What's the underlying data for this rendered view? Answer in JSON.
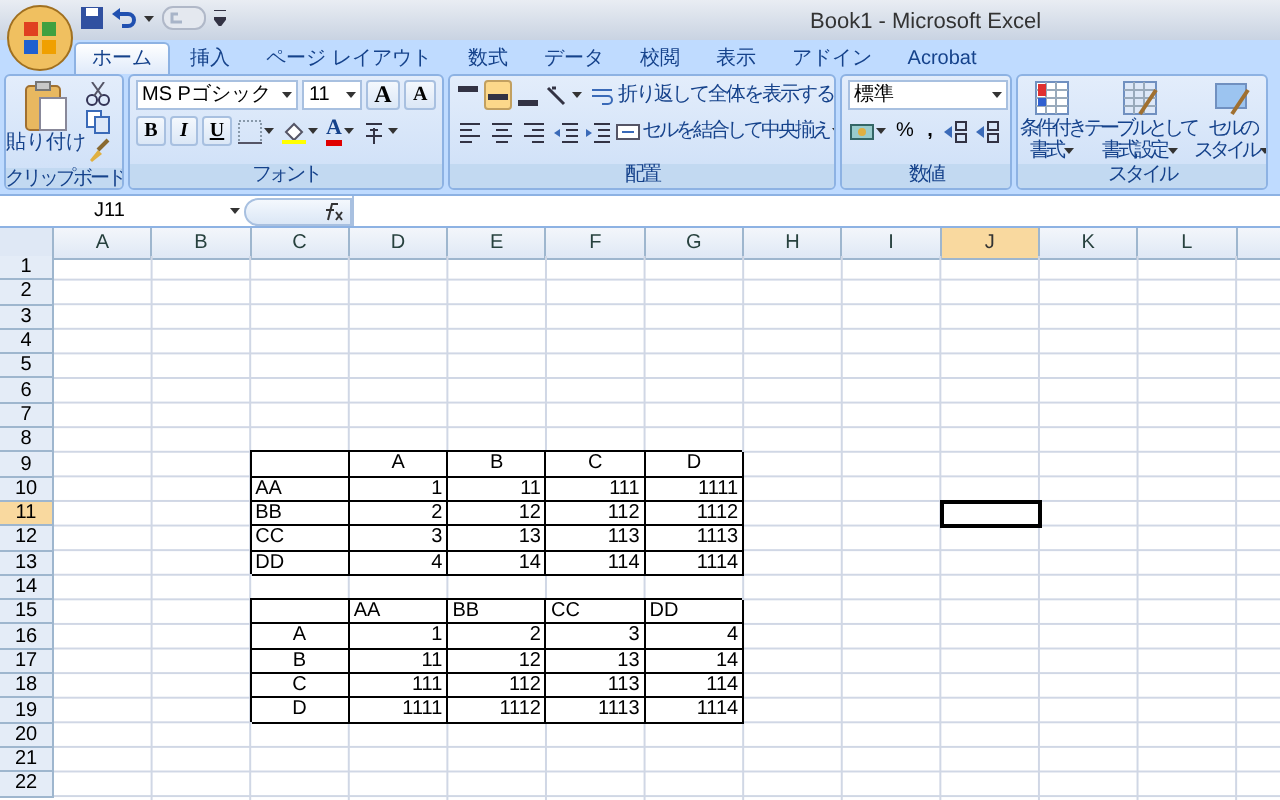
{
  "title_bar": {
    "title": "Book1 - Microsoft Excel"
  },
  "tabs": [
    {
      "label": "ホーム",
      "selected": true
    },
    {
      "label": "挿入",
      "selected": false
    },
    {
      "label": "ページ レイアウト",
      "selected": false
    },
    {
      "label": "数式",
      "selected": false
    },
    {
      "label": "データ",
      "selected": false
    },
    {
      "label": "校閲",
      "selected": false
    },
    {
      "label": "表示",
      "selected": false
    },
    {
      "label": "アドイン",
      "selected": false
    },
    {
      "label": "Acrobat",
      "selected": false
    }
  ],
  "ribbon": {
    "clipboard": {
      "label": "クリップボード",
      "paste": "貼り付け"
    },
    "font": {
      "label": "フォント",
      "font_name": "MS Pゴシック",
      "font_size": "11",
      "grow": "A",
      "shrink": "A",
      "bold": "B",
      "italic": "I",
      "underline": "U",
      "font_color": "A"
    },
    "alignment": {
      "label": "配置",
      "wrap_text": "折り返して全体を表示する",
      "merge_center": "セルを結合して中央揃え",
      "vertical_align": [
        {
          "selected": false
        },
        {
          "selected": true
        },
        {
          "selected": false
        }
      ]
    },
    "number": {
      "label": "数値",
      "format": "標準",
      "percent": "%",
      "comma": ","
    },
    "styles": {
      "label": "スタイル",
      "buttons": [
        {
          "lines": [
            "条件付き",
            "書式"
          ]
        },
        {
          "lines": [
            "テーブルとして",
            "書式設定"
          ]
        },
        {
          "lines": [
            "セルの",
            "スタイル"
          ]
        }
      ]
    }
  },
  "formula_bar": {
    "name_box": "J11"
  },
  "sheet": {
    "columns": [
      {
        "label": "A",
        "selected": false
      },
      {
        "label": "B",
        "selected": false
      },
      {
        "label": "C",
        "selected": false
      },
      {
        "label": "D",
        "selected": false
      },
      {
        "label": "E",
        "selected": false
      },
      {
        "label": "F",
        "selected": false
      },
      {
        "label": "G",
        "selected": false
      },
      {
        "label": "H",
        "selected": false
      },
      {
        "label": "I",
        "selected": false
      },
      {
        "label": "J",
        "selected": true
      },
      {
        "label": "K",
        "selected": false
      },
      {
        "label": "L",
        "selected": false
      }
    ],
    "rows": [
      {
        "label": "1",
        "selected": false
      },
      {
        "label": "2",
        "selected": false
      },
      {
        "label": "3",
        "selected": false
      },
      {
        "label": "4",
        "selected": false
      },
      {
        "label": "5",
        "selected": false
      },
      {
        "label": "6",
        "selected": false
      },
      {
        "label": "7",
        "selected": false
      },
      {
        "label": "8",
        "selected": false
      },
      {
        "label": "9",
        "selected": false,
        "cells": [
          {},
          {},
          {
            "bordered": true
          },
          {
            "value": "A",
            "kind": "heading",
            "bordered": true
          },
          {
            "value": "B",
            "kind": "heading",
            "bordered": true
          },
          {
            "value": "C",
            "kind": "heading",
            "bordered": true
          },
          {
            "value": "D",
            "kind": "heading",
            "bordered": true
          }
        ]
      },
      {
        "label": "10",
        "selected": false,
        "cells": [
          {},
          {},
          {
            "value": "AA",
            "kind": "label",
            "bordered": true
          },
          {
            "value": "1",
            "kind": "number",
            "bordered": true
          },
          {
            "value": "11",
            "kind": "number",
            "bordered": true
          },
          {
            "value": "111",
            "kind": "number",
            "bordered": true
          },
          {
            "value": "1111",
            "kind": "number",
            "bordered": true
          }
        ]
      },
      {
        "label": "11",
        "selected": true,
        "cells": [
          {},
          {},
          {
            "value": "BB",
            "kind": "label",
            "bordered": true
          },
          {
            "value": "2",
            "kind": "number",
            "bordered": true
          },
          {
            "value": "12",
            "kind": "number",
            "bordered": true
          },
          {
            "value": "112",
            "kind": "number",
            "bordered": true
          },
          {
            "value": "1112",
            "kind": "number",
            "bordered": true
          }
        ]
      },
      {
        "label": "12",
        "selected": false,
        "cells": [
          {},
          {},
          {
            "value": "CC",
            "kind": "label",
            "bordered": true
          },
          {
            "value": "3",
            "kind": "number",
            "bordered": true
          },
          {
            "value": "13",
            "kind": "number",
            "bordered": true
          },
          {
            "value": "113",
            "kind": "number",
            "bordered": true
          },
          {
            "value": "1113",
            "kind": "number",
            "bordered": true
          }
        ]
      },
      {
        "label": "13",
        "selected": false,
        "cells": [
          {},
          {},
          {
            "value": "DD",
            "kind": "label",
            "bordered": true
          },
          {
            "value": "4",
            "kind": "number",
            "bordered": true
          },
          {
            "value": "14",
            "kind": "number",
            "bordered": true
          },
          {
            "value": "114",
            "kind": "number",
            "bordered": true
          },
          {
            "value": "1114",
            "kind": "number",
            "bordered": true
          }
        ]
      },
      {
        "label": "14",
        "selected": false
      },
      {
        "label": "15",
        "selected": false,
        "cells": [
          {},
          {},
          {
            "bordered": true
          },
          {
            "value": "AA",
            "kind": "label",
            "bordered": true
          },
          {
            "value": "BB",
            "kind": "label",
            "bordered": true
          },
          {
            "value": "CC",
            "kind": "label",
            "bordered": true
          },
          {
            "value": "DD",
            "kind": "label",
            "bordered": true
          }
        ]
      },
      {
        "label": "16",
        "selected": false,
        "cells": [
          {},
          {},
          {
            "value": "A",
            "kind": "heading",
            "bordered": true
          },
          {
            "value": "1",
            "kind": "number",
            "bordered": true
          },
          {
            "value": "2",
            "kind": "number",
            "bordered": true
          },
          {
            "value": "3",
            "kind": "number",
            "bordered": true
          },
          {
            "value": "4",
            "kind": "number",
            "bordered": true
          }
        ]
      },
      {
        "label": "17",
        "selected": false,
        "cells": [
          {},
          {},
          {
            "value": "B",
            "kind": "heading",
            "bordered": true
          },
          {
            "value": "11",
            "kind": "number",
            "bordered": true
          },
          {
            "value": "12",
            "kind": "number",
            "bordered": true
          },
          {
            "value": "13",
            "kind": "number",
            "bordered": true
          },
          {
            "value": "14",
            "kind": "number",
            "bordered": true
          }
        ]
      },
      {
        "label": "18",
        "selected": false,
        "cells": [
          {},
          {},
          {
            "value": "C",
            "kind": "heading",
            "bordered": true
          },
          {
            "value": "111",
            "kind": "number",
            "bordered": true
          },
          {
            "value": "112",
            "kind": "number",
            "bordered": true
          },
          {
            "value": "113",
            "kind": "number",
            "bordered": true
          },
          {
            "value": "114",
            "kind": "number",
            "bordered": true
          }
        ]
      },
      {
        "label": "19",
        "selected": false,
        "cells": [
          {},
          {},
          {
            "value": "D",
            "kind": "heading",
            "bordered": true
          },
          {
            "value": "1111",
            "kind": "number",
            "bordered": true
          },
          {
            "value": "1112",
            "kind": "number",
            "bordered": true
          },
          {
            "value": "1113",
            "kind": "number",
            "bordered": true
          },
          {
            "value": "1114",
            "kind": "number",
            "bordered": true
          }
        ]
      },
      {
        "label": "20",
        "selected": false
      },
      {
        "label": "21",
        "selected": false
      },
      {
        "label": "22",
        "selected": false
      }
    ]
  }
}
